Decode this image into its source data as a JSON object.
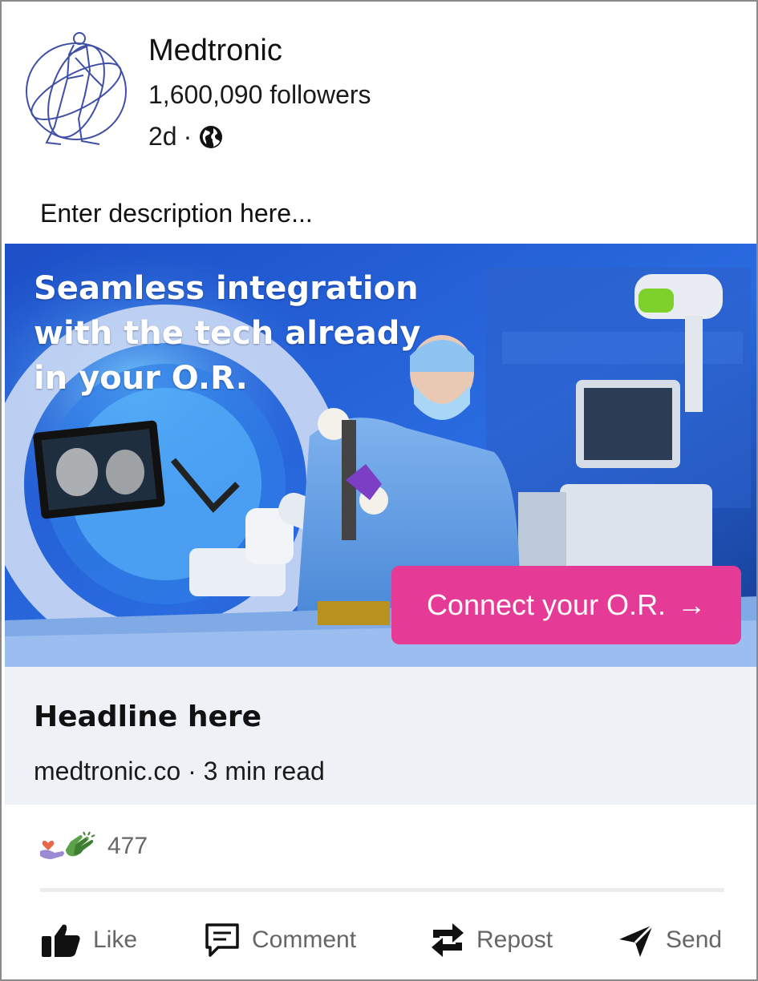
{
  "post": {
    "company": "Medtronic",
    "followers": "1,600,090 followers",
    "age": "2d",
    "separator": "·",
    "visibility_icon": "globe-icon",
    "description": "Enter description here..."
  },
  "ad": {
    "title": "Seamless integration with the tech already in your O.R.",
    "cta_label": "Connect your O.R.",
    "cta_arrow": "→",
    "cta_color": "#e53a96"
  },
  "preview": {
    "headline": "Headline here",
    "source": "medtronic.co · 3 min read"
  },
  "social": {
    "reaction_count": "477",
    "reaction_icons": [
      "support-heart-icon",
      "celebrate-clap-icon"
    ]
  },
  "actions": {
    "like": "Like",
    "comment": "Comment",
    "repost": "Repost",
    "send": "Send"
  }
}
